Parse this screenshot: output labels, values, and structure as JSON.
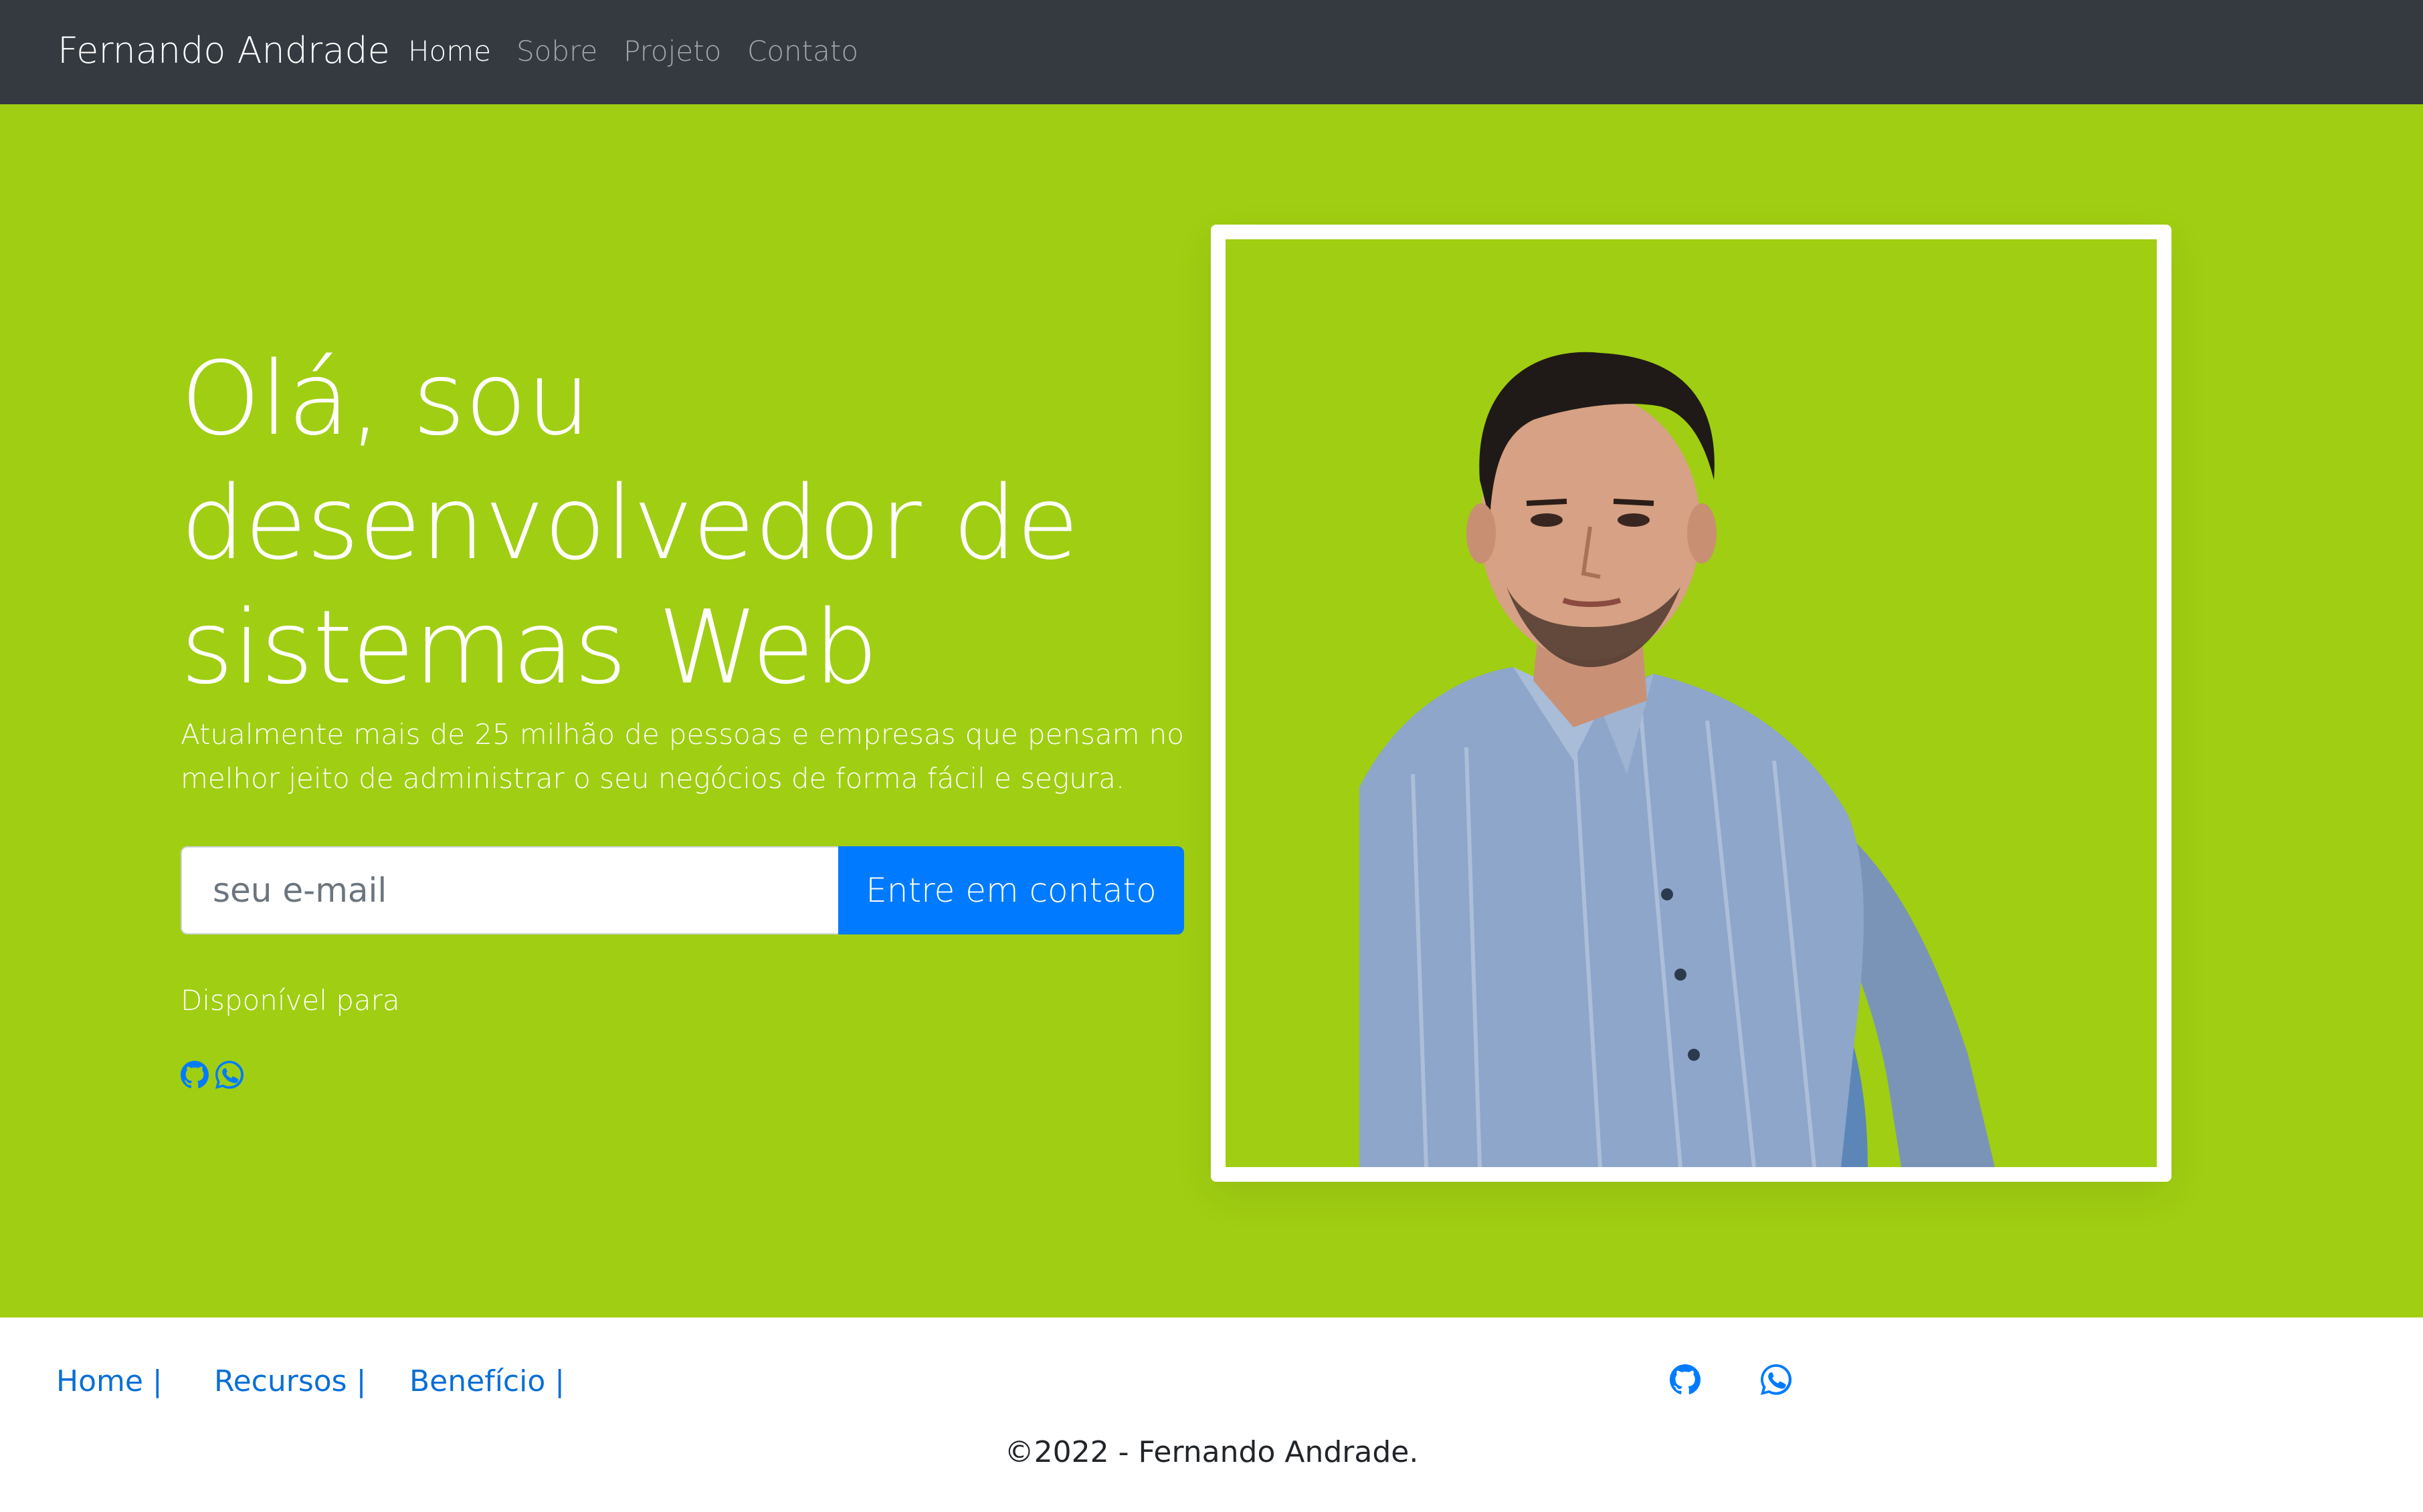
{
  "nav": {
    "brand": "Fernando Andrade",
    "links": [
      {
        "label": "Home",
        "active": true
      },
      {
        "label": "Sobre",
        "active": false
      },
      {
        "label": "Projeto",
        "active": false
      },
      {
        "label": "Contato",
        "active": false
      }
    ]
  },
  "hero": {
    "title_lines": [
      "Olá, sou",
      "desenvolvedor de",
      "sistemas Web"
    ],
    "description": "Atualmente mais de 25 milhão de pessoas e empresas que pensam no melhor jeito de administrar o seu negócios de forma fácil e segura.",
    "email_placeholder": "seu e-mail",
    "email_value": "",
    "button_label": "Entre em contato",
    "available_label": "Disponível para",
    "social_icons": [
      "github-icon",
      "whatsapp-icon"
    ]
  },
  "photo": {
    "description_icon": "portrait-photo"
  },
  "footer": {
    "links": [
      "Home |",
      "Recursos |",
      "Benefício |"
    ],
    "social_icons": [
      "github-icon",
      "whatsapp-icon"
    ],
    "copyright": "©2022 - Fernando Andrade."
  },
  "colors": {
    "navbar_bg": "#343a40",
    "hero_bg": "#a0ce12",
    "primary": "#007bff",
    "link": "#0a6fd6",
    "white": "#ffffff"
  }
}
